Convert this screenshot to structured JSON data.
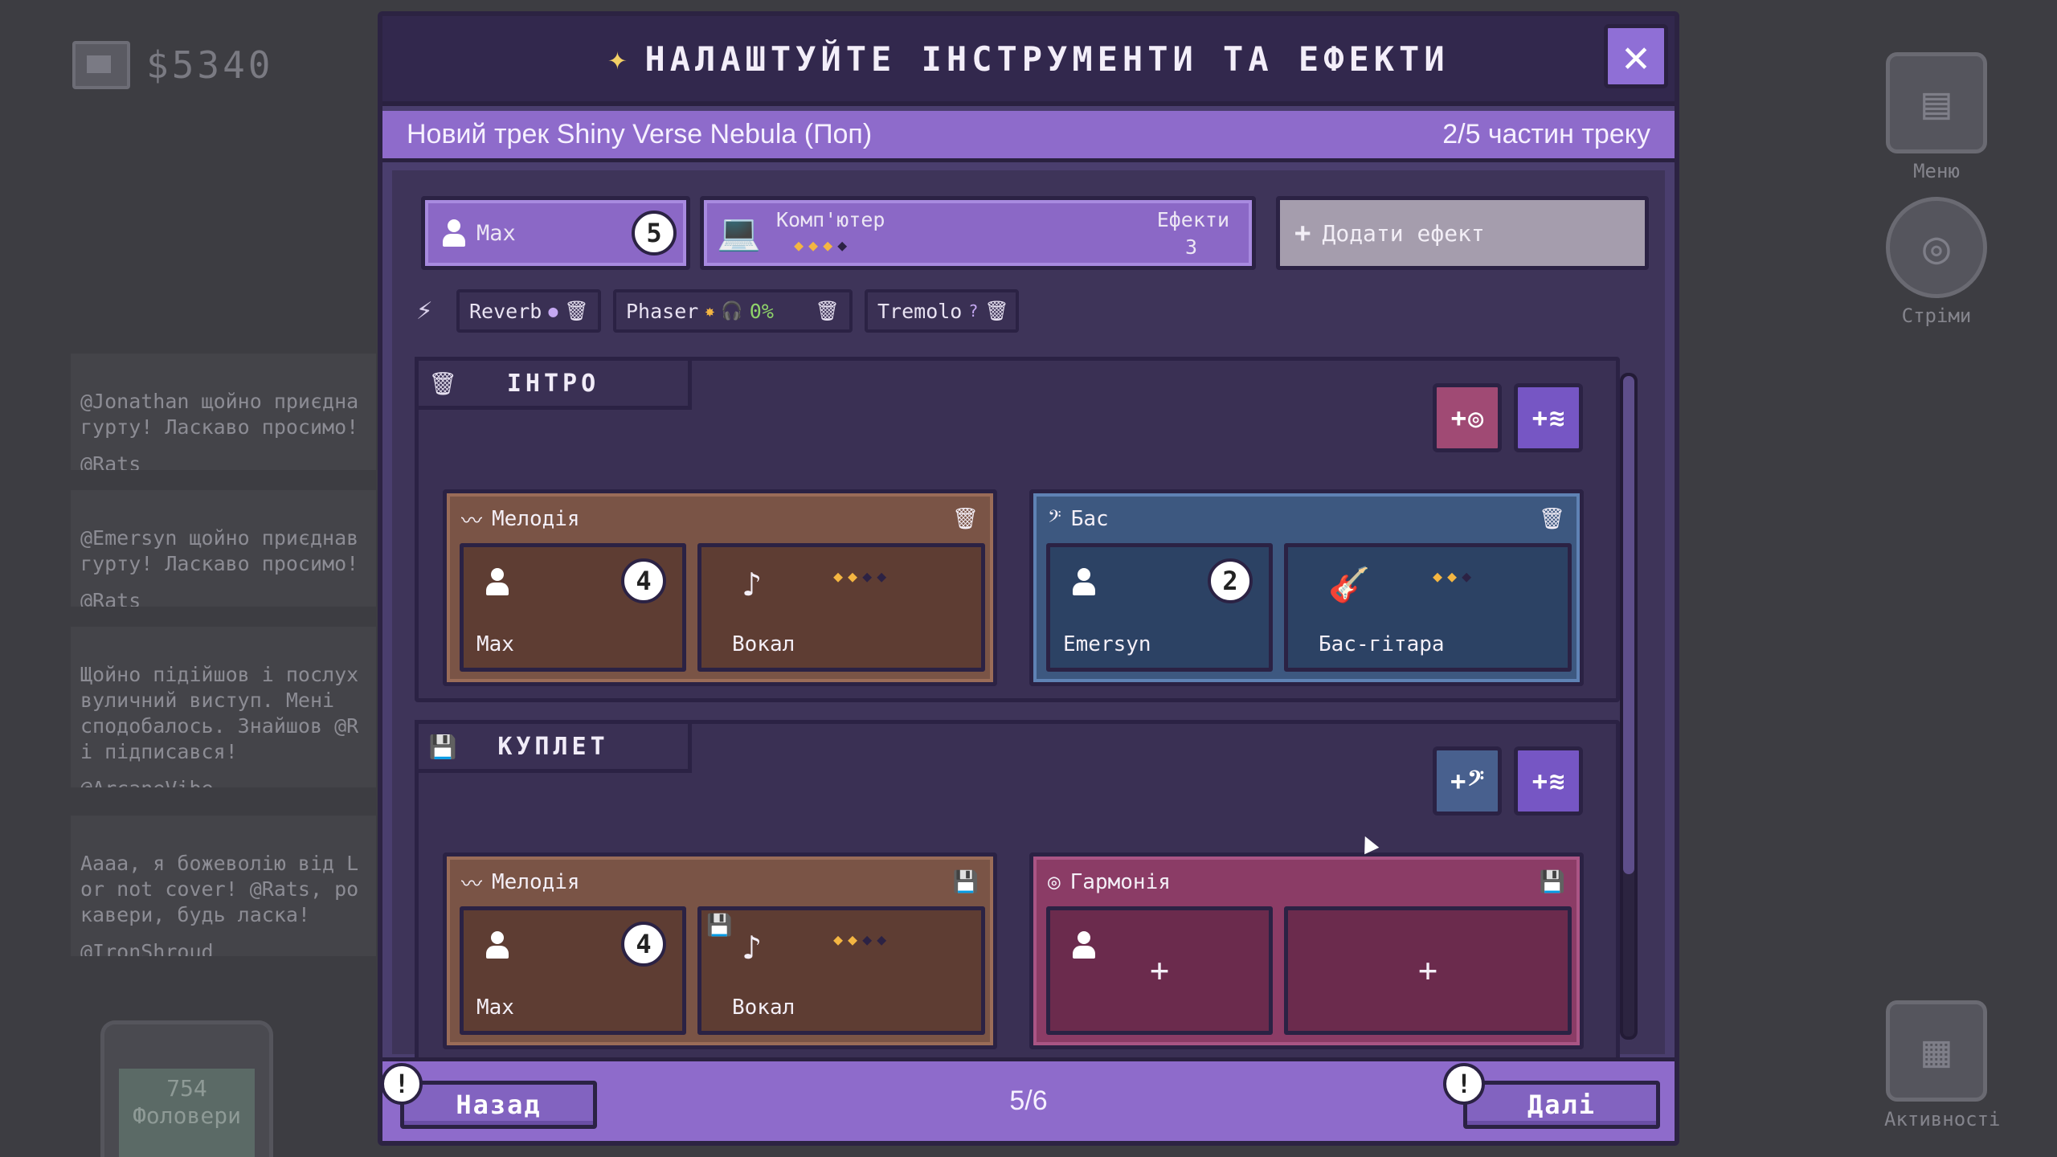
{
  "hud": {
    "money": "$5340",
    "followers_count": "754",
    "followers_label": "Фоловери",
    "menu_label": "Меню",
    "streams_label": "Стріми",
    "activities_label": "Активності"
  },
  "feed": [
    {
      "text": "@Jonathan щойно приєдна\nгурту! Ласкаво просимо!",
      "who": "@Rats"
    },
    {
      "text": "@Emersyn щойно приєднав\nгурту! Ласкаво просимо!",
      "who": "@Rats"
    },
    {
      "text": "Щойно підійшов і послух\nвуличний виступ. Мені\nсподобалось. Знайшов @R\nі підписався!",
      "who": "@ArcaneVibe"
    },
    {
      "text": "Аааа, я божеволію від L\nor not cover! @Rats, po\nкавери, будь ласка!",
      "who": "@IronShroud"
    }
  ],
  "modal": {
    "title": "НАЛАШТУЙТЕ ІНСТРУМЕНТИ ТА ЕФЕКТИ",
    "track_name": "Новий трек Shiny Verse Nebula (Поп)",
    "track_parts": "2/5 частин треку",
    "musician": {
      "name": "Max",
      "level": "5"
    },
    "instrument": {
      "name": "Комп'ютер",
      "stars_on": 3,
      "stars_total": 4,
      "effects_label": "Ефекти",
      "effects_count": "3"
    },
    "add_effect_label": "Додати ефект",
    "effects": [
      {
        "name": "Reverb",
        "extra": ""
      },
      {
        "name": "Phaser",
        "extra": "0%"
      },
      {
        "name": "Tremolo",
        "extra": ""
      }
    ],
    "sections": [
      {
        "label": "ІНТРО",
        "parts": [
          {
            "title": "Мелодія",
            "musician": "Max",
            "level": "4",
            "instrument": "Вокал",
            "stars_on": 2,
            "stars_total": 4
          },
          {
            "title": "Бас",
            "musician": "Emersyn",
            "level": "2",
            "instrument": "Бас-гітара",
            "stars_on": 2,
            "stars_total": 3
          }
        ]
      },
      {
        "label": "КУПЛЕТ",
        "parts": [
          {
            "title": "Мелодія",
            "musician": "Max",
            "level": "4",
            "instrument": "Вокал",
            "stars_on": 2,
            "stars_total": 4
          },
          {
            "title": "Гармонія",
            "musician": "",
            "level": "",
            "instrument": "",
            "add_symbol": "+"
          }
        ]
      }
    ],
    "footer": {
      "back_label": "Назад",
      "next_label": "Далі",
      "page": "5/6",
      "alert_symbol": "!"
    }
  }
}
